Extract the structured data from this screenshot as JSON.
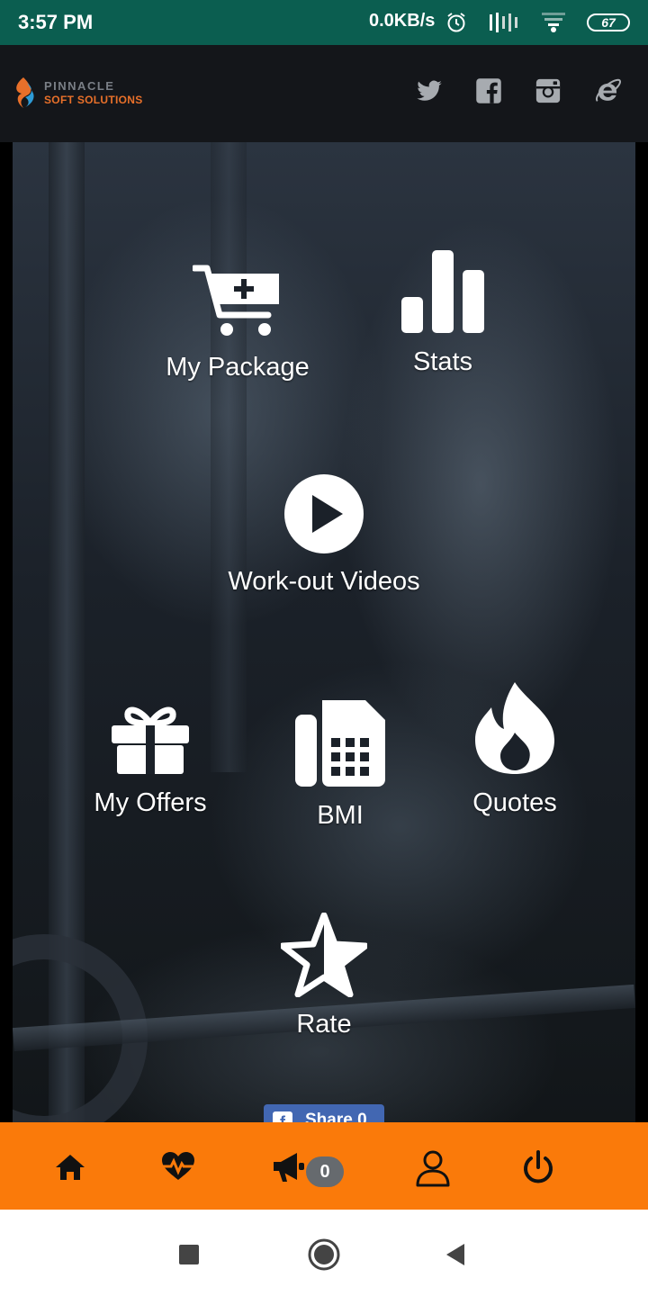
{
  "status_bar": {
    "time": "3:57 PM",
    "network_speed": "0.0KB/s",
    "battery": "67",
    "icons": [
      "alarm-icon",
      "signal-icon",
      "wifi-icon",
      "battery-icon"
    ]
  },
  "header": {
    "logo_line1": "PINNACLE",
    "logo_line2": "SOFT SOLUTIONS",
    "social_icons": [
      "twitter-icon",
      "facebook-icon",
      "instagram-icon",
      "internet-explorer-icon"
    ]
  },
  "menu": {
    "my_package": "My Package",
    "stats": "Stats",
    "workout_videos": "Work-out Videos",
    "my_offers": "My Offers",
    "bmi": "BMI",
    "quotes": "Quotes",
    "rate": "Rate"
  },
  "share": {
    "label": "Share",
    "count": "0"
  },
  "bottom_nav": {
    "items": [
      "home-icon",
      "heartbeat-icon",
      "megaphone-icon",
      "user-icon",
      "power-icon"
    ],
    "notification_count": "0"
  },
  "colors": {
    "status_bar": "#0b5e50",
    "header": "#14161a",
    "accent": "#fa7a0a",
    "badge": "#666a6e",
    "share": "#4267b2"
  }
}
